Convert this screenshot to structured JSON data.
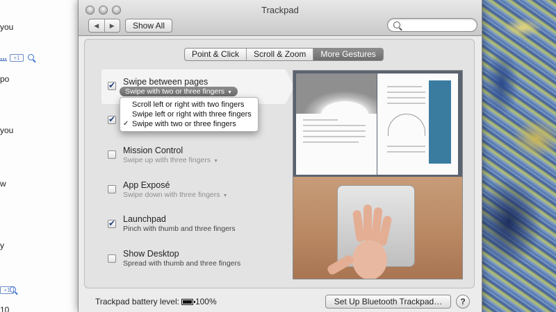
{
  "background_left": {
    "fragments": [
      {
        "text": "you",
        "link": false
      },
      {
        "text": "...",
        "link": true
      },
      {
        "text": "po",
        "link": false
      },
      {
        "text": "you",
        "link": false
      },
      {
        "text": "w",
        "link": false
      },
      {
        "text": "y",
        "link": false
      },
      {
        "text": "10",
        "link": false
      }
    ],
    "pill_label": "+1"
  },
  "window": {
    "title": "Trackpad",
    "nav_back": "◀",
    "nav_forward": "▶",
    "show_all": "Show All",
    "search_placeholder": ""
  },
  "tabs": [
    {
      "label": "Point & Click",
      "active": false
    },
    {
      "label": "Scroll & Zoom",
      "active": false
    },
    {
      "label": "More Gestures",
      "active": true
    }
  ],
  "gestures": [
    {
      "label": "Swipe between pages",
      "sub": "Swipe with two or three fingers",
      "checked": true,
      "sub_style": "pill"
    },
    {
      "label": "",
      "sub": "",
      "checked": true,
      "sub_style": "hidden"
    },
    {
      "label": "Mission Control",
      "sub": "Swipe up with three fingers",
      "checked": false,
      "sub_style": "dropdown"
    },
    {
      "label": "App Exposé",
      "sub": "Swipe down with three fingers",
      "checked": false,
      "sub_style": "dropdown"
    },
    {
      "label": "Launchpad",
      "sub": "Pinch with thumb and three fingers",
      "checked": true,
      "sub_style": "plain"
    },
    {
      "label": "Show Desktop",
      "sub": "Spread with thumb and three fingers",
      "checked": false,
      "sub_style": "plain"
    }
  ],
  "dropdown_options": [
    {
      "label": "Scroll left or right with two fingers",
      "selected": false
    },
    {
      "label": "Swipe left or right with three fingers",
      "selected": false
    },
    {
      "label": "Swipe with two or three fingers",
      "selected": true
    }
  ],
  "footer": {
    "battery_label": "Trackpad battery level:",
    "battery_value": "100%",
    "setup_button": "Set Up Bluetooth Trackpad…",
    "help": "?"
  },
  "icons": {
    "dropdown_arrow": "▼",
    "check": "✓"
  }
}
